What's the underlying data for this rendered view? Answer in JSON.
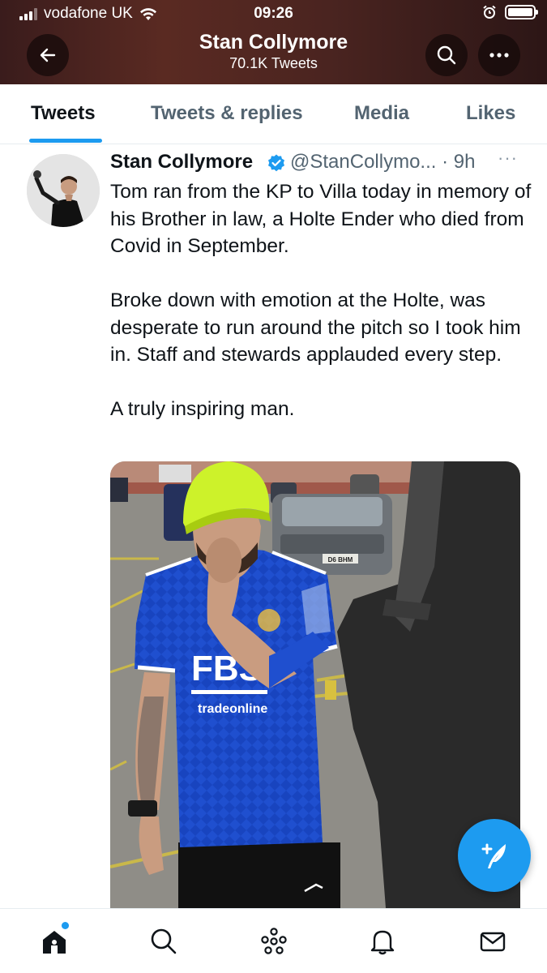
{
  "status_bar": {
    "carrier": "vodafone UK",
    "time": "09:26"
  },
  "header": {
    "title": "Stan Collymore",
    "subtitle": "70.1K Tweets"
  },
  "tabs": [
    {
      "label": "Tweets",
      "active": true
    },
    {
      "label": "Tweets & replies",
      "active": false
    },
    {
      "label": "Media",
      "active": false
    },
    {
      "label": "Likes",
      "active": false
    }
  ],
  "tweet": {
    "author_name": "Stan Collymore",
    "handle_time": "@StanCollymo... · 9h",
    "more": "···",
    "paragraphs": [
      "Tom ran from the KP to Villa today in memory of his Brother in law, a Holte Ender who died from Covid in September.",
      "Broke down with emotion at the Holte, was desperate to run around the pitch so I took him in. Staff and stewards applauded every step.",
      "A truly inspiring man."
    ],
    "media": {
      "shirt_sponsor": "FBS",
      "shirt_sub": "tradeonline",
      "plate": "D6 BHM"
    }
  },
  "icons": {
    "back": "arrow-left-icon",
    "search": "search-icon",
    "more": "more-horizontal-icon",
    "verified": "verified-badge-icon",
    "compose": "compose-feather-icon",
    "nav": [
      "home-icon",
      "search-icon",
      "spaces-icon",
      "bell-icon",
      "mail-icon"
    ]
  },
  "colors": {
    "accent": "#1d9bf0",
    "header_bg": "#4a2420"
  }
}
